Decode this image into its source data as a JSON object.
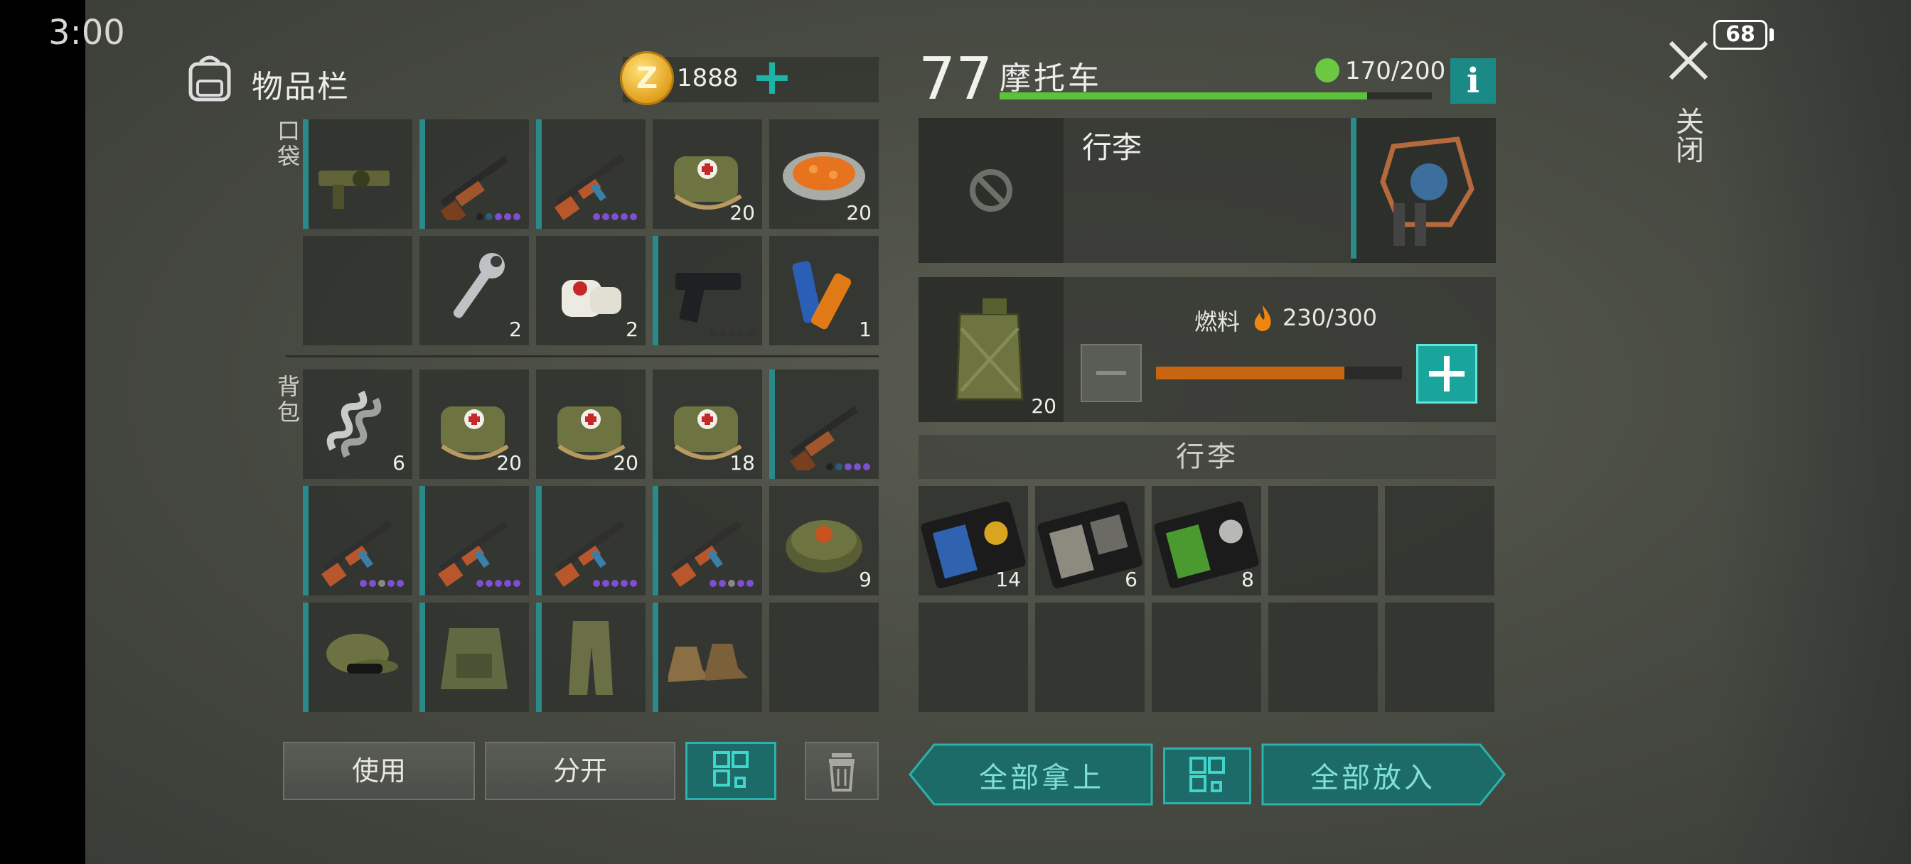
{
  "status_bar": {
    "time": "3:00",
    "battery": "68"
  },
  "close": {
    "label": "关闭"
  },
  "inventory": {
    "title": "物品栏",
    "currency": "1888",
    "pocket_label": "口袋",
    "backpack_label": "背包",
    "pocket_items": [
      {
        "name": "grenade-launcher",
        "count": "",
        "quality": []
      },
      {
        "name": "shotgun",
        "count": "",
        "quality": [
          "#222",
          "#2c5a7a",
          "#7d4fd1",
          "#7d4fd1",
          "#7d4fd1"
        ]
      },
      {
        "name": "ak-rifle",
        "count": "",
        "quality": [
          "#7d4fd1",
          "#7d4fd1",
          "#7d4fd1",
          "#7d4fd1",
          "#7d4fd1"
        ]
      },
      {
        "name": "medkit-bag",
        "count": "20",
        "quality": []
      },
      {
        "name": "carrot-stew-bowl",
        "count": "20",
        "quality": []
      },
      {
        "name": "empty",
        "count": "",
        "quality": []
      },
      {
        "name": "wrench",
        "count": "2",
        "quality": []
      },
      {
        "name": "bandage",
        "count": "2",
        "quality": []
      },
      {
        "name": "pistol",
        "count": "",
        "quality": [
          "#333",
          "#333",
          "#333",
          "#333",
          "#333"
        ]
      },
      {
        "name": "batteries",
        "count": "1",
        "quality": []
      }
    ],
    "backpack_items": [
      {
        "name": "spring-coil",
        "count": "6",
        "quality": []
      },
      {
        "name": "medkit-bag",
        "count": "20",
        "quality": []
      },
      {
        "name": "medkit-bag",
        "count": "20",
        "quality": []
      },
      {
        "name": "medkit-bag",
        "count": "18",
        "quality": []
      },
      {
        "name": "shotgun",
        "count": "",
        "quality": [
          "#222",
          "#2c5a7a",
          "#7d4fd1",
          "#7d4fd1",
          "#7d4fd1"
        ]
      },
      {
        "name": "ak-rifle",
        "count": "",
        "quality": [
          "#7d4fd1",
          "#7d4fd1",
          "#888",
          "#7d4fd1",
          "#7d4fd1"
        ]
      },
      {
        "name": "ak-rifle",
        "count": "",
        "quality": [
          "#7d4fd1",
          "#7d4fd1",
          "#7d4fd1",
          "#7d4fd1",
          "#7d4fd1"
        ]
      },
      {
        "name": "ak-rifle",
        "count": "",
        "quality": [
          "#7d4fd1",
          "#7d4fd1",
          "#7d4fd1",
          "#7d4fd1",
          "#7d4fd1"
        ]
      },
      {
        "name": "ak-rifle",
        "count": "",
        "quality": [
          "#7d4fd1",
          "#7d4fd1",
          "#888",
          "#7d4fd1",
          "#7d4fd1"
        ]
      },
      {
        "name": "landmine",
        "count": "9",
        "quality": []
      },
      {
        "name": "camo-cap",
        "count": "",
        "quality": []
      },
      {
        "name": "camo-vest",
        "count": "",
        "quality": []
      },
      {
        "name": "camo-pants",
        "count": "",
        "quality": []
      },
      {
        "name": "boots",
        "count": "",
        "quality": []
      },
      {
        "name": "empty",
        "count": "",
        "quality": []
      }
    ],
    "buttons": {
      "use": "使用",
      "split": "分开"
    }
  },
  "vehicle": {
    "level": "77",
    "name": "摩托车",
    "durability": "170/200",
    "durability_ratio": 0.85,
    "luggage_title": "行李",
    "fuel_label": "燃料",
    "fuel_value": "230/300",
    "fuel_ratio": 0.7667,
    "fuel_item_count": "20",
    "cargo_header": "行李",
    "cargo_items": [
      {
        "name": "blue-id-card",
        "count": "14"
      },
      {
        "name": "patrol-officer-card",
        "count": "6"
      },
      {
        "name": "green-id-card",
        "count": "8"
      },
      {
        "name": "empty",
        "count": ""
      },
      {
        "name": "empty",
        "count": ""
      },
      {
        "name": "empty",
        "count": ""
      },
      {
        "name": "empty",
        "count": ""
      },
      {
        "name": "empty",
        "count": ""
      },
      {
        "name": "empty",
        "count": ""
      },
      {
        "name": "empty",
        "count": ""
      }
    ],
    "buttons": {
      "take_all": "全部拿上",
      "put_all": "全部放入"
    }
  },
  "colors": {
    "accent_teal": "#1fb3a6",
    "hp_green": "#5bc23a",
    "fuel_orange": "#c9650e"
  }
}
